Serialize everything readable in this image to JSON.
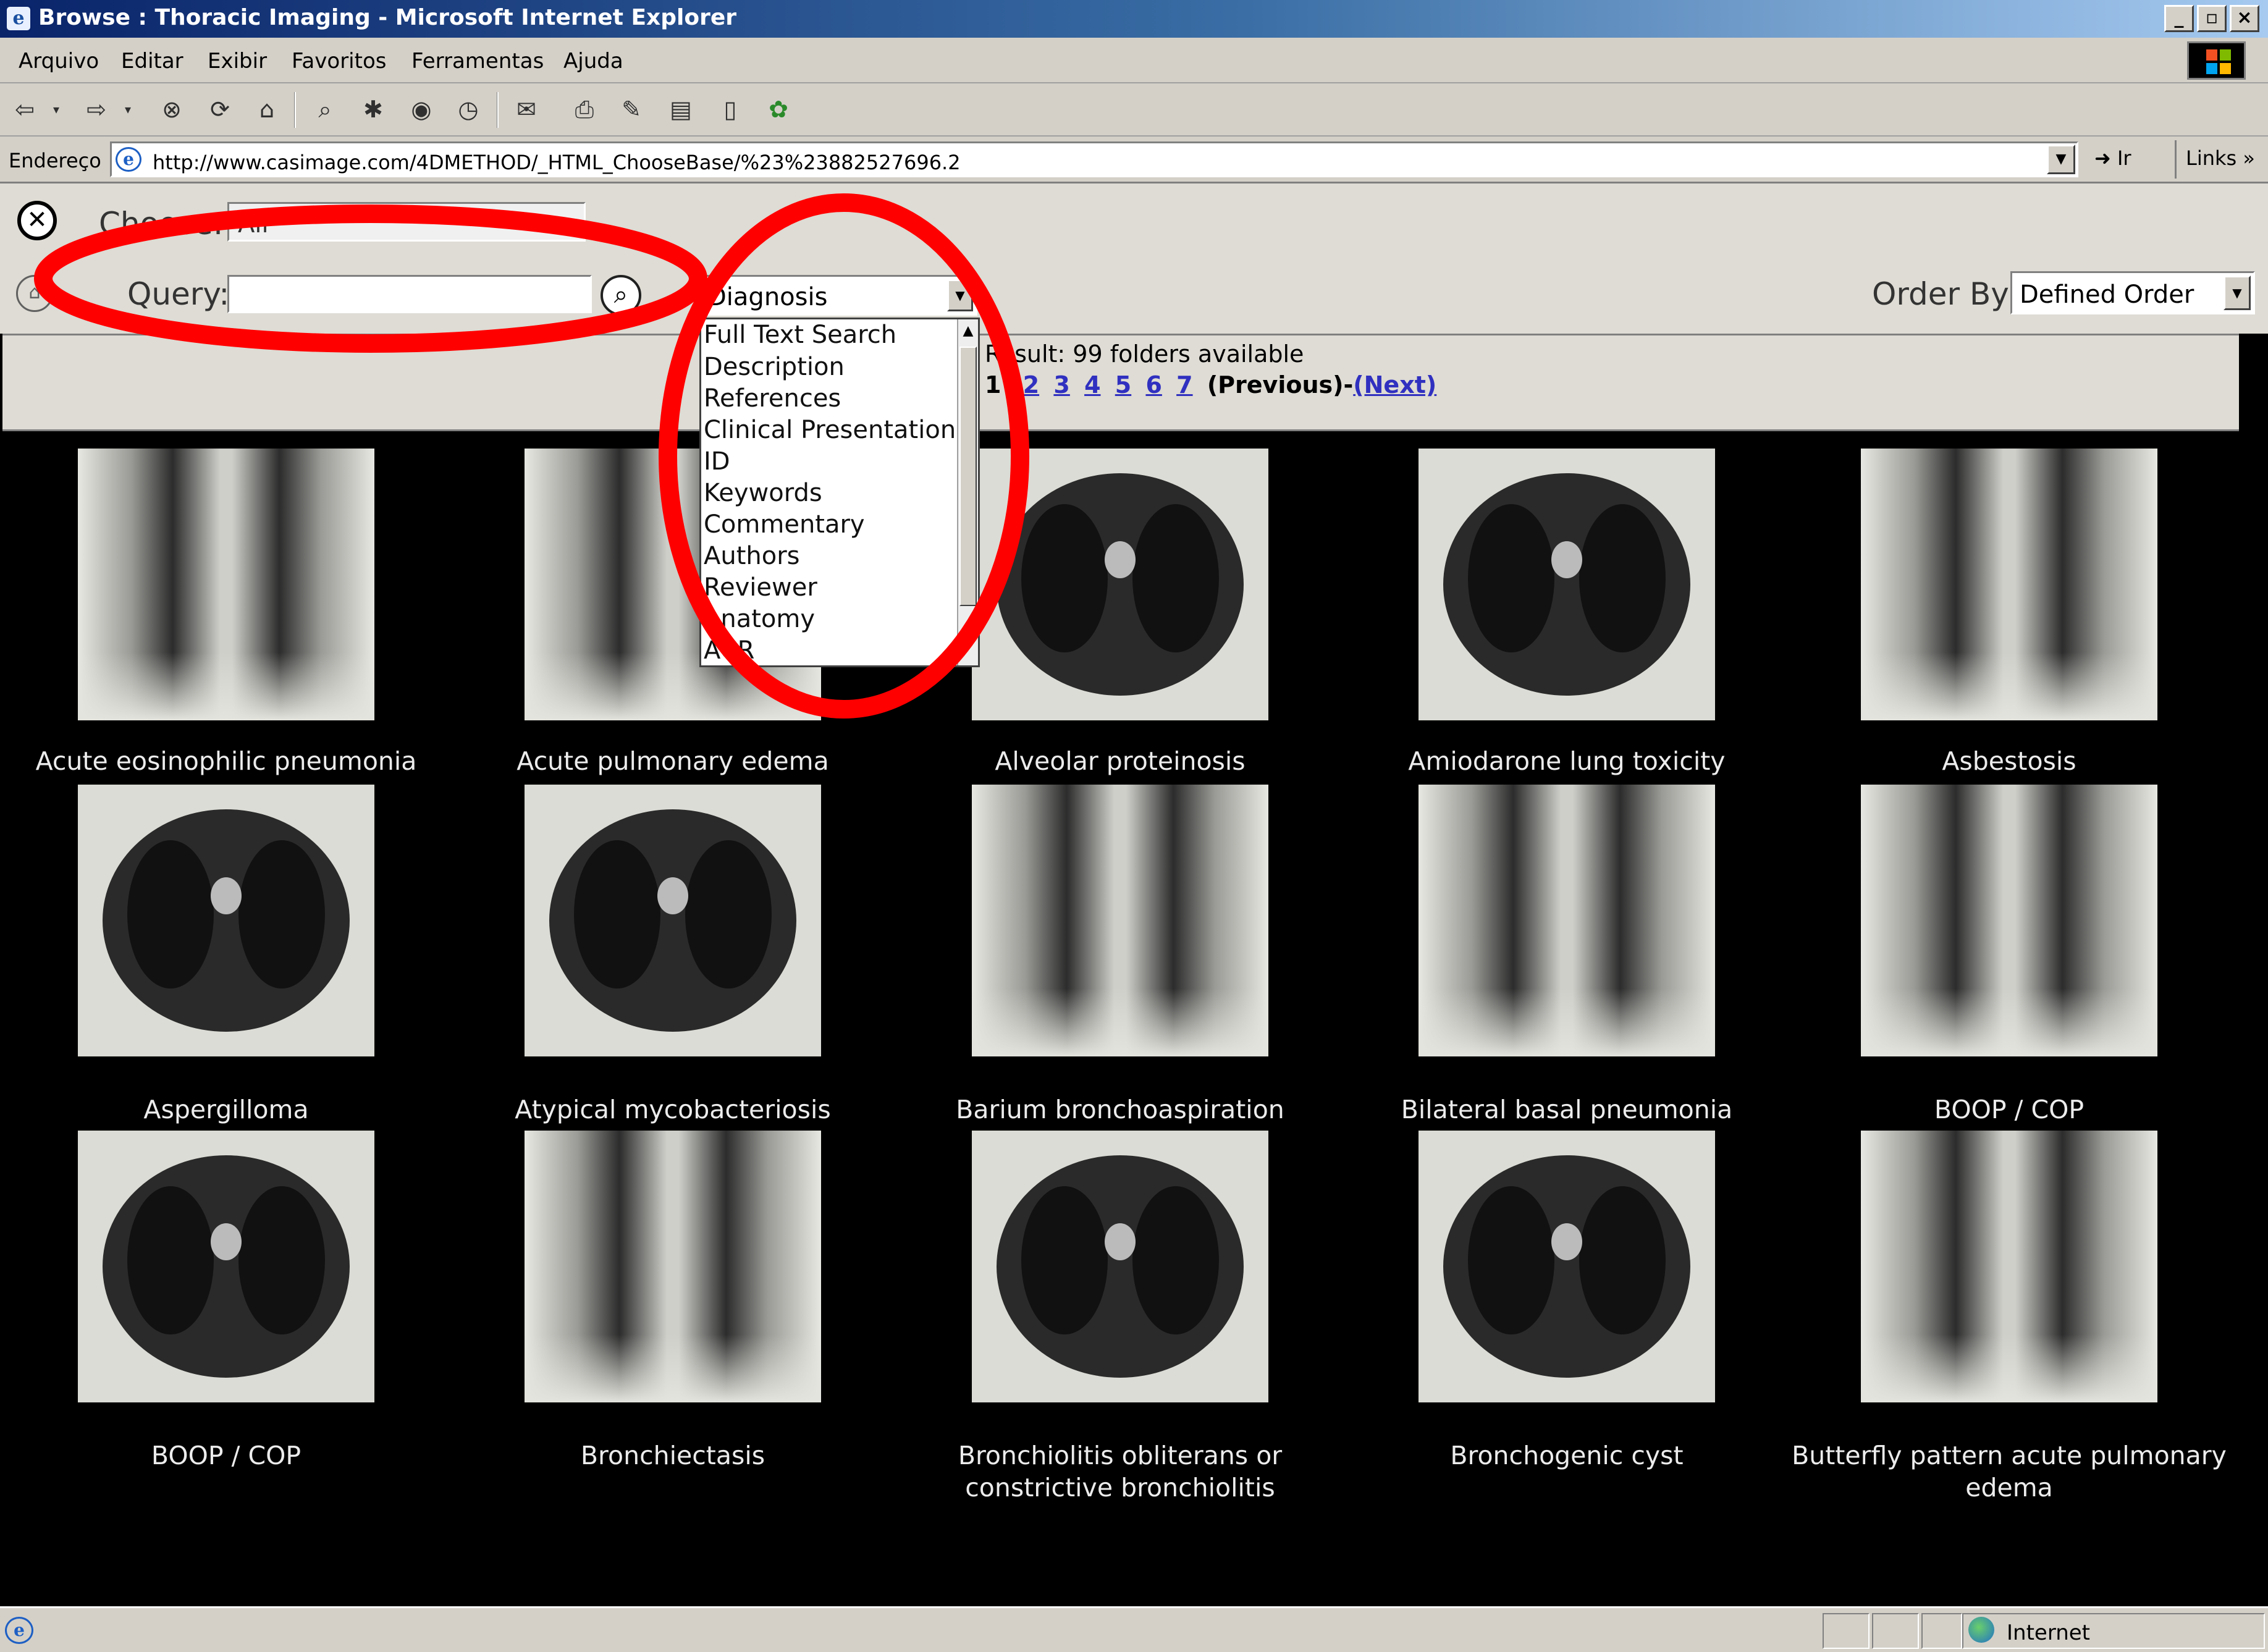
{
  "window": {
    "title": "Browse : Thoracic Imaging - Microsoft Internet Explorer",
    "controls": [
      "_",
      "▫",
      "×"
    ]
  },
  "menu": [
    "Arquivo",
    "Editar",
    "Exibir",
    "Favoritos",
    "Ferramentas",
    "Ajuda"
  ],
  "address": {
    "label": "Endereço",
    "url": "http://www.casimage.com/4DMETHOD/_HTML_ChooseBase/%23%23882527696.2",
    "go_label": "Ir",
    "links_label": "Links"
  },
  "search": {
    "choose_label": "Choose:",
    "choose_value": "All",
    "query_label": "Query:",
    "query_value": "",
    "field_selected": "Diagnosis",
    "field_options": [
      "Full Text Search",
      "Description",
      "References",
      "Clinical Presentation",
      "ID",
      "Keywords",
      "Commentary",
      "Authors",
      "Reviewer",
      "Anatomy",
      "ACR"
    ],
    "order_label": "Order By:",
    "order_value": "Defined Order"
  },
  "results": {
    "text": "Result: 99 folders available",
    "current_page": "1",
    "pages": [
      "2",
      "3",
      "4",
      "5",
      "6",
      "7"
    ],
    "previous_label": "(Previous)-",
    "next_label": "(Next)"
  },
  "gallery": [
    {
      "caption": "Acute eosinophilic pneumonia",
      "kind": "cxr"
    },
    {
      "caption": "Acute pulmonary edema",
      "kind": "cxr"
    },
    {
      "caption": "Alveolar proteinosis",
      "kind": "ct"
    },
    {
      "caption": "Amiodarone lung toxicity",
      "kind": "ct"
    },
    {
      "caption": "Asbestosis",
      "kind": "cxr"
    },
    {
      "caption": "Aspergilloma",
      "kind": "ct"
    },
    {
      "caption": "Atypical mycobacteriosis",
      "kind": "ct"
    },
    {
      "caption": "Barium bronchoaspiration",
      "kind": "cxr"
    },
    {
      "caption": "Bilateral basal pneumonia",
      "kind": "cxr"
    },
    {
      "caption": "BOOP / COP",
      "kind": "cxr"
    },
    {
      "caption": "BOOP / COP",
      "kind": "ct"
    },
    {
      "caption": "Bronchiectasis",
      "kind": "cxr"
    },
    {
      "caption": "Bronchiolitis obliterans or constrictive bronchiolitis",
      "kind": "ct"
    },
    {
      "caption": "Bronchogenic cyst",
      "kind": "ct"
    },
    {
      "caption": "Butterfly pattern acute pulmonary edema",
      "kind": "cxr"
    }
  ],
  "status": {
    "zone": "Internet"
  },
  "colors": {
    "annotation_red": "#ff0000",
    "link_blue": "#3030c0",
    "panel_gray": "#dedcd4",
    "chrome_gray": "#d4d0c8"
  }
}
